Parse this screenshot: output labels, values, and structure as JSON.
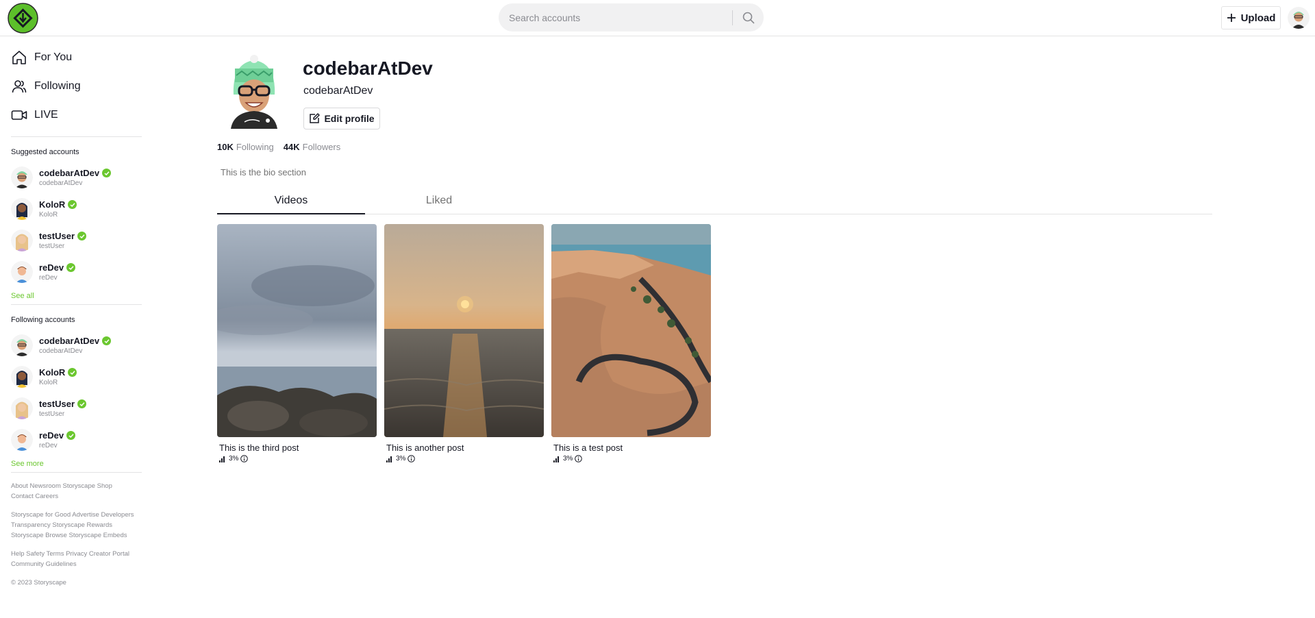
{
  "header": {
    "search_placeholder": "Search accounts",
    "upload_label": "Upload"
  },
  "nav": [
    {
      "label": "For You",
      "icon": "home-icon"
    },
    {
      "label": "Following",
      "icon": "users-icon"
    },
    {
      "label": "LIVE",
      "icon": "video-camera-icon"
    }
  ],
  "suggested": {
    "title": "Suggested accounts",
    "accounts": [
      {
        "name": "codebarAtDev",
        "handle": "codebarAtDev"
      },
      {
        "name": "KoloR",
        "handle": "KoloR"
      },
      {
        "name": "testUser",
        "handle": "testUser"
      },
      {
        "name": "reDev",
        "handle": "reDev"
      }
    ],
    "see_all": "See all"
  },
  "following": {
    "title": "Following accounts",
    "accounts": [
      {
        "name": "codebarAtDev",
        "handle": "codebarAtDev"
      },
      {
        "name": "KoloR",
        "handle": "KoloR"
      },
      {
        "name": "testUser",
        "handle": "testUser"
      },
      {
        "name": "reDev",
        "handle": "reDev"
      }
    ],
    "see_more": "See more"
  },
  "footer": {
    "line1": "About Newsroom Storyscape Shop Contact Careers",
    "line2": "Storyscape for Good Advertise Developers Transparency Storyscape Rewards Storyscape Browse Storyscape Embeds",
    "line3": "Help Safety Terms Privacy Creator Portal Community Guidelines",
    "copyright": "© 2023 Storyscape"
  },
  "profile": {
    "name": "codebarAtDev",
    "handle": "codebarAtDev",
    "edit_label": "Edit profile",
    "following_count": "10K",
    "following_label": "Following",
    "followers_count": "44K",
    "followers_label": "Followers",
    "bio": "This is the bio section"
  },
  "tabs": [
    {
      "label": "Videos",
      "active": true
    },
    {
      "label": "Liked",
      "active": false
    }
  ],
  "videos": [
    {
      "caption": "This is the third post",
      "stat": "3%"
    },
    {
      "caption": "This is another post",
      "stat": "3%"
    },
    {
      "caption": "This is a test post",
      "stat": "3%"
    }
  ],
  "colors": {
    "accent_green": "#6bc72f",
    "logo_green": "#5cbf2a"
  }
}
